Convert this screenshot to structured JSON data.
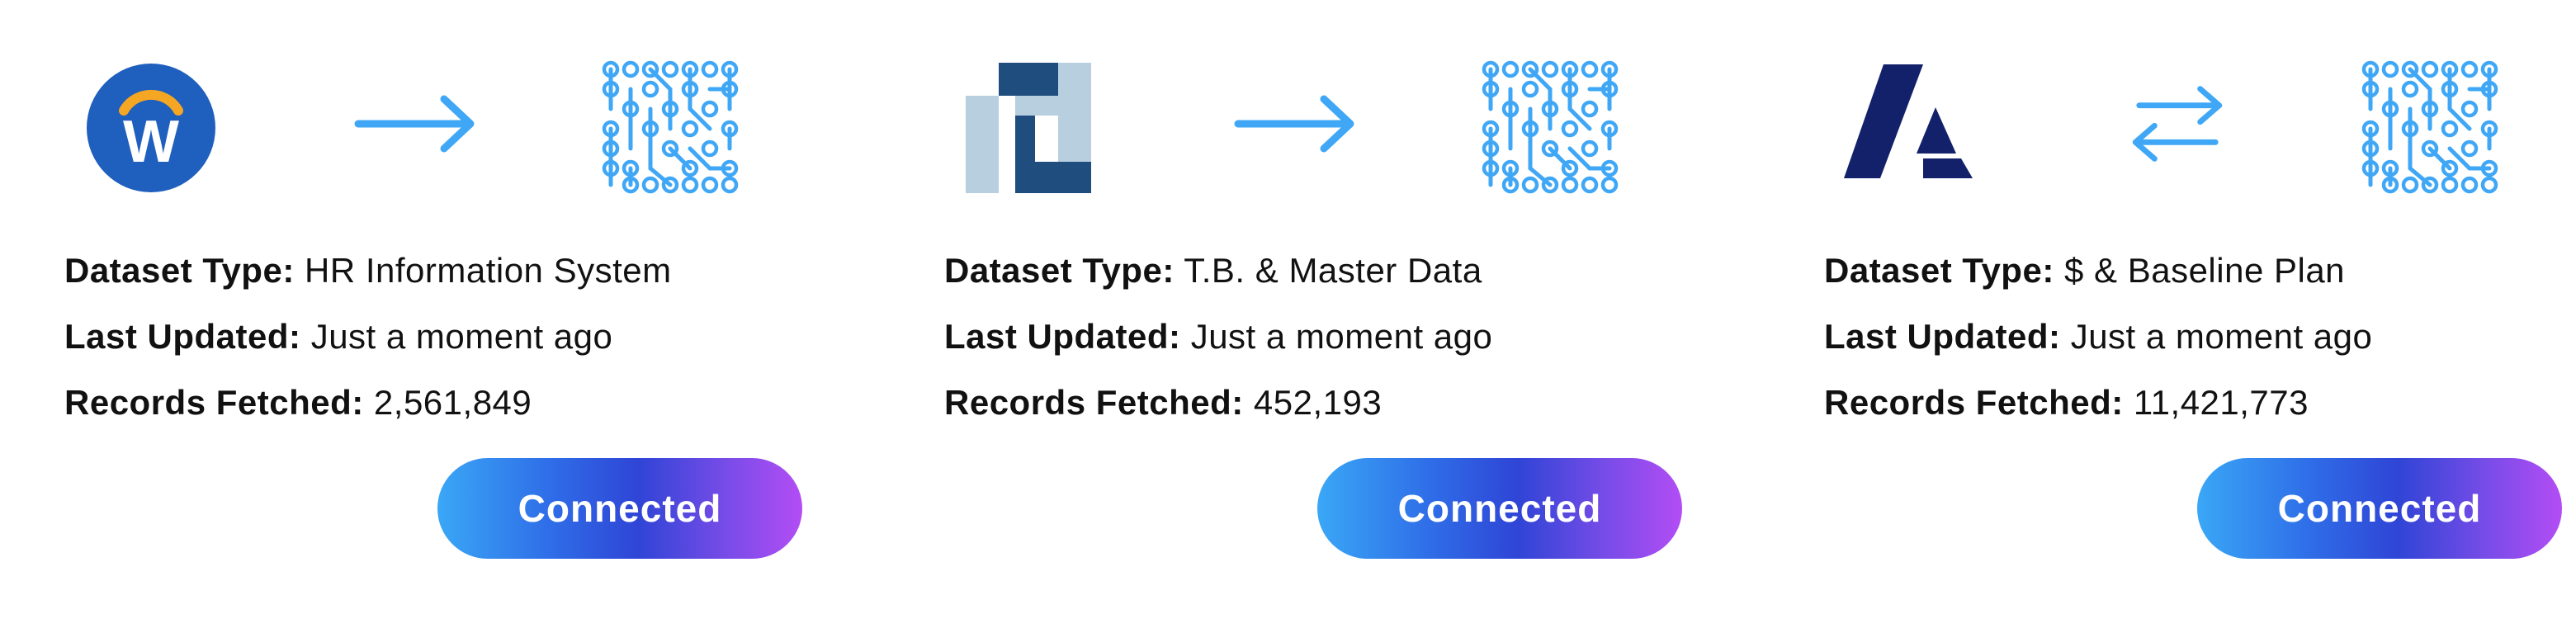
{
  "connectors": [
    {
      "source_icon": "workday-logo-icon",
      "source_letter": "W",
      "direction_icon": "arrow-right-icon",
      "direction": "one-way",
      "target_icon": "circuit-grid-icon",
      "dataset_type_label": "Dataset Type:",
      "dataset_type": "HR Information System",
      "last_updated_label": "Last Updated:",
      "last_updated": "Just a moment ago",
      "records_label": "Records Fetched:",
      "records": "2,561,849",
      "button_label": "Connected"
    },
    {
      "source_icon": "netsuite-logo-icon",
      "direction_icon": "arrow-right-icon",
      "direction": "one-way",
      "target_icon": "circuit-grid-icon",
      "dataset_type_label": "Dataset Type:",
      "dataset_type": "T.B. & Master Data",
      "last_updated_label": "Last Updated:",
      "last_updated": "Just a moment ago",
      "records_label": "Records Fetched:",
      "records": "452,193",
      "button_label": "Connected"
    },
    {
      "source_icon": "anaplan-logo-icon",
      "direction_icon": "arrows-bidirectional-icon",
      "direction": "two-way",
      "target_icon": "circuit-grid-icon",
      "dataset_type_label": "Dataset Type:",
      "dataset_type": "$ & Baseline Plan",
      "last_updated_label": "Last Updated:",
      "last_updated": "Just a moment ago",
      "records_label": "Records Fetched:",
      "records": "11,421,773",
      "button_label": "Connected"
    }
  ],
  "colors": {
    "arrow": "#3fa7f5",
    "circuit": "#3fa7f5",
    "workday_blue": "#1f5fbd",
    "workday_arc": "#f5a623",
    "netsuite_dark": "#1f4e7e",
    "netsuite_light": "#b8cfdf",
    "anaplan_navy": "#13216a",
    "button_gradient": [
      "#3aa7f6",
      "#2f45d6",
      "#b34df5"
    ],
    "text": "#111111"
  }
}
